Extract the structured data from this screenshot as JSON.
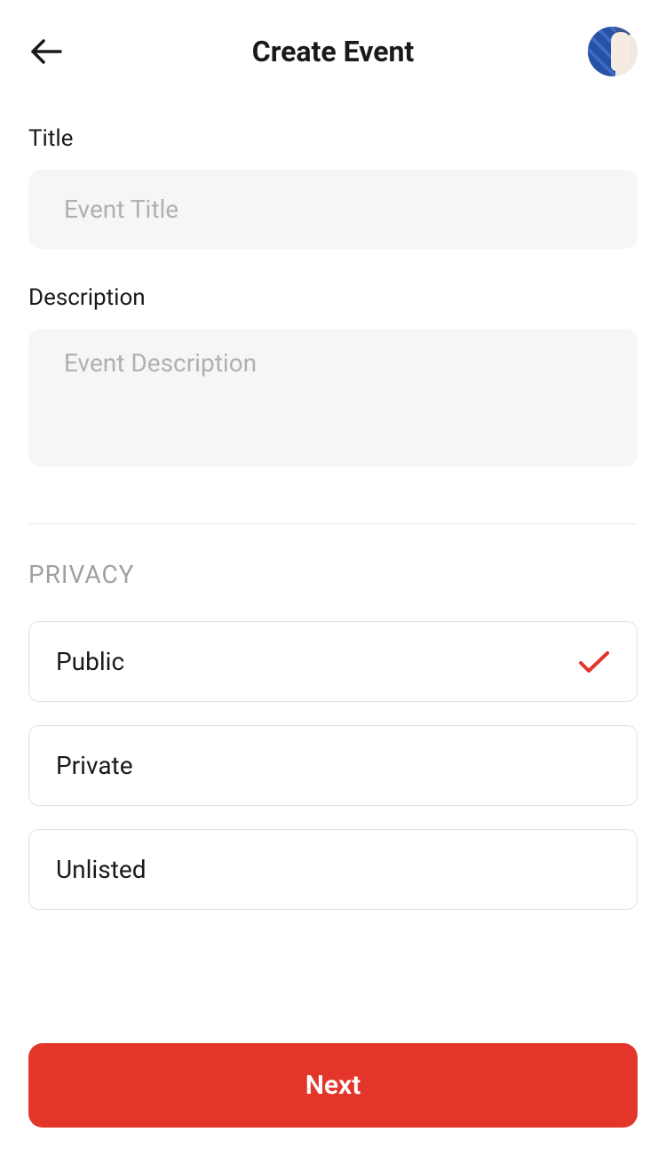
{
  "header": {
    "title": "Create Event"
  },
  "form": {
    "title": {
      "label": "Title",
      "placeholder": "Event Title",
      "value": ""
    },
    "description": {
      "label": "Description",
      "placeholder": "Event Description",
      "value": ""
    }
  },
  "privacy": {
    "section_label": "PRIVACY",
    "options": [
      {
        "label": "Public",
        "selected": true
      },
      {
        "label": "Private",
        "selected": false
      },
      {
        "label": "Unlisted",
        "selected": false
      }
    ]
  },
  "footer": {
    "next_label": "Next"
  }
}
